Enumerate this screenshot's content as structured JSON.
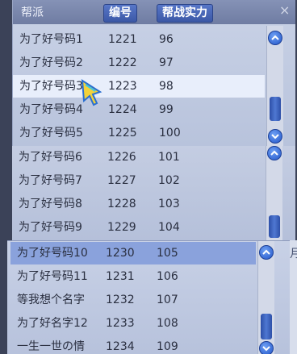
{
  "header": {
    "guild_label": "帮派",
    "number_label": "编号",
    "power_label": "帮战实力",
    "close_glyph": "×"
  },
  "panel1": {
    "rows": [
      {
        "name": "为了好号码1",
        "number": "1221",
        "power": "96"
      },
      {
        "name": "为了好号码2",
        "number": "1222",
        "power": "97"
      },
      {
        "name": "为了好号码3",
        "number": "1223",
        "power": "98"
      },
      {
        "name": "为了好号码4",
        "number": "1224",
        "power": "99"
      },
      {
        "name": "为了好号码5",
        "number": "1225",
        "power": "100"
      }
    ]
  },
  "panel2": {
    "rows": [
      {
        "name": "为了好号码6",
        "number": "1226",
        "power": "101"
      },
      {
        "name": "为了好号码7",
        "number": "1227",
        "power": "102"
      },
      {
        "name": "为了好号码8",
        "number": "1228",
        "power": "103"
      },
      {
        "name": "为了好号码9",
        "number": "1229",
        "power": "104"
      }
    ]
  },
  "panel3": {
    "rows": [
      {
        "name": "为了好号码10",
        "number": "1230",
        "power": "105"
      },
      {
        "name": "为了好号码11",
        "number": "1231",
        "power": "106"
      },
      {
        "name": "等我想个名字",
        "number": "1232",
        "power": "107"
      },
      {
        "name": "为了好名字12",
        "number": "1233",
        "power": "108"
      },
      {
        "name": "一生一世の情",
        "number": "1234",
        "power": "109"
      }
    ],
    "edge_char": "月"
  },
  "colors": {
    "header_bg": "#6f7ca2",
    "header_button": "#3c58a6",
    "selected_row": "#e8eefb",
    "highlight_row": "#8aa2dc",
    "scroll_button": "#2255c8"
  },
  "icons": {
    "scroll_up": "chevron-up-icon",
    "scroll_down": "chevron-down-icon",
    "cursor": "pointer-cursor-icon"
  }
}
